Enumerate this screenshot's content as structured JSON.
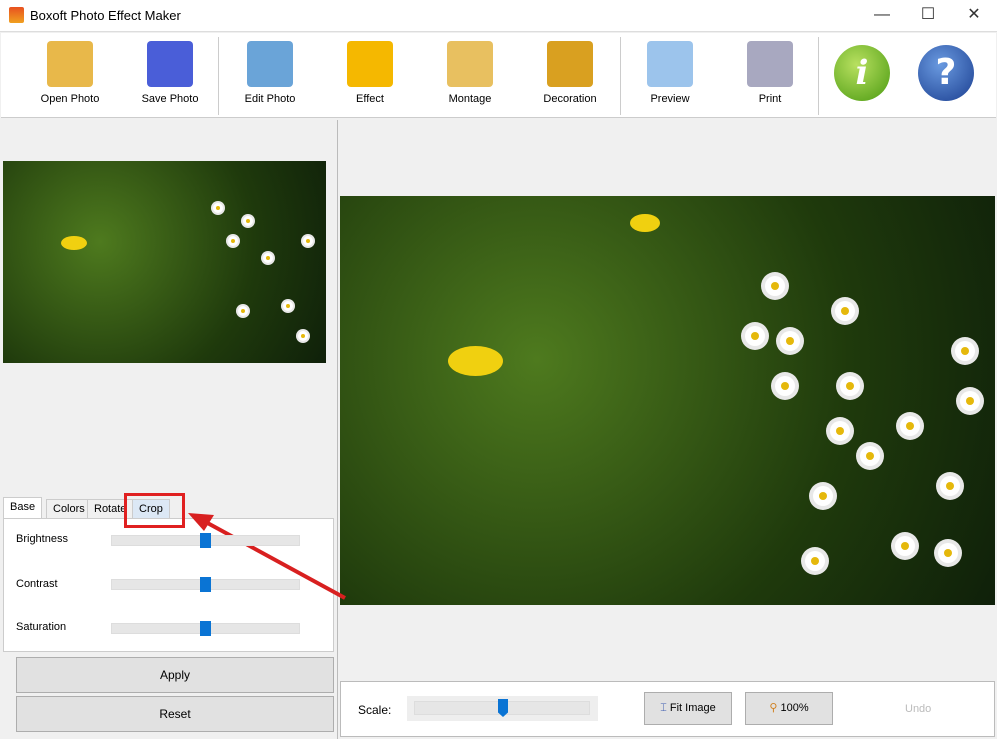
{
  "window": {
    "title": "Boxoft Photo Effect Maker",
    "minimize": "—",
    "maximize": "☐",
    "close": "✕"
  },
  "toolbar": [
    {
      "label": "Open Photo",
      "icon": "open-folder-icon",
      "color": "#e8b84a"
    },
    {
      "label": "Save Photo",
      "icon": "floppy-disk-icon",
      "color": "#4a5ed8"
    },
    {
      "label": "Edit Photo",
      "icon": "edit-photo-icon",
      "color": "#6aa4d8"
    },
    {
      "label": "Effect",
      "icon": "sun-icon",
      "color": "#f5b800"
    },
    {
      "label": "Montage",
      "icon": "montage-icon",
      "color": "#e8c060"
    },
    {
      "label": "Decoration",
      "icon": "decoration-frame-icon",
      "color": "#d9a020"
    },
    {
      "label": "Preview",
      "icon": "preview-magnifier-icon",
      "color": "#9cc4ec"
    },
    {
      "label": "Print",
      "icon": "printer-icon",
      "color": "#a8a8c0"
    }
  ],
  "info_icon": "i",
  "help_icon": "?",
  "tabs": [
    "Base",
    "Colors",
    "Rotate",
    "Crop"
  ],
  "adjustments": [
    {
      "label": "Brightness",
      "value": 50
    },
    {
      "label": "Contrast",
      "value": 50
    },
    {
      "label": "Saturation",
      "value": 50
    }
  ],
  "apply": "Apply",
  "reset": "Reset",
  "bottom": {
    "scale_label": "Scale:",
    "scale_value": 50,
    "fit": "Fit Image",
    "zoom100": "100%",
    "undo": "Undo"
  }
}
